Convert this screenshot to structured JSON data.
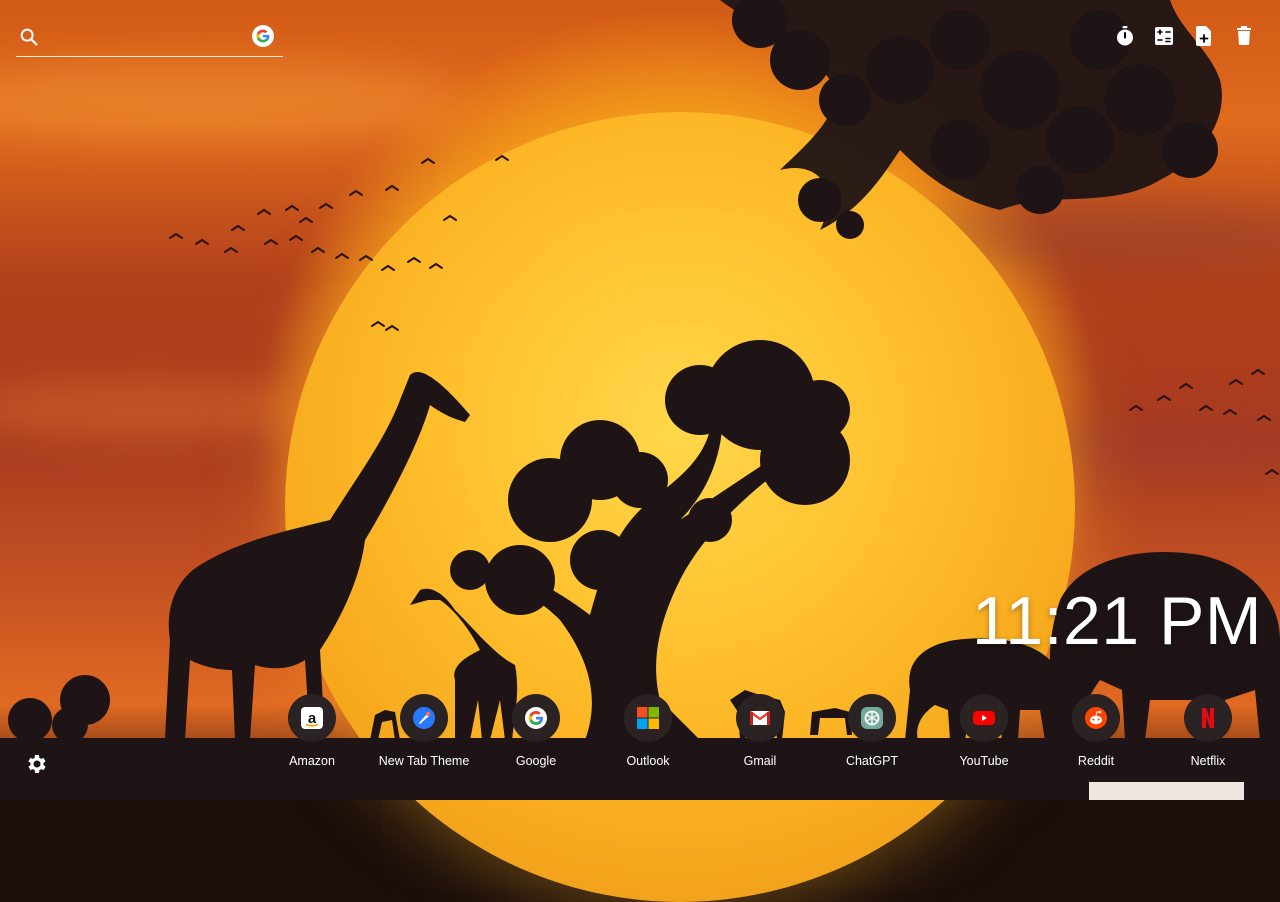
{
  "search": {
    "placeholder": "",
    "engine_icon": "google-icon"
  },
  "toolbar": {
    "tools": [
      {
        "name": "timer-icon"
      },
      {
        "name": "calculator-icon"
      },
      {
        "name": "add-note-icon"
      },
      {
        "name": "trash-icon"
      }
    ]
  },
  "clock": {
    "time": "11:21 PM"
  },
  "shortcuts": [
    {
      "label": "Amazon",
      "icon": "amazon-icon"
    },
    {
      "label": "New Tab Theme",
      "icon": "new-tab-theme-icon"
    },
    {
      "label": "Google",
      "icon": "google-icon"
    },
    {
      "label": "Outlook",
      "icon": "outlook-icon"
    },
    {
      "label": "Gmail",
      "icon": "gmail-icon"
    },
    {
      "label": "ChatGPT",
      "icon": "chatgpt-icon"
    },
    {
      "label": "YouTube",
      "icon": "youtube-icon"
    },
    {
      "label": "Reddit",
      "icon": "reddit-icon"
    },
    {
      "label": "Netflix",
      "icon": "netflix-icon"
    }
  ],
  "settings": {
    "icon": "gear-icon"
  },
  "colors": {
    "sky_top": "#d15a16",
    "moon": "#f6a81d",
    "silhouette": "#1e1415",
    "text": "#ffffff"
  }
}
